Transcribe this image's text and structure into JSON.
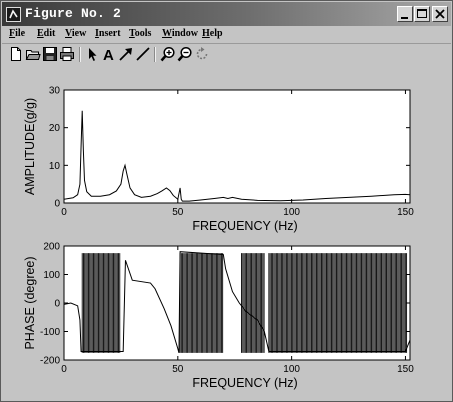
{
  "window": {
    "title": "Figure No. 2"
  },
  "menu": [
    {
      "label": "File",
      "u": "F",
      "rest": "ile"
    },
    {
      "label": "Edit",
      "u": "E",
      "rest": "dit"
    },
    {
      "label": "View",
      "u": "V",
      "rest": "iew"
    },
    {
      "label": "Insert",
      "u": "I",
      "rest": "nsert"
    },
    {
      "label": "Tools",
      "u": "T",
      "rest": "ools"
    },
    {
      "label": "Window",
      "u": "W",
      "rest": "indow"
    },
    {
      "label": "Help",
      "u": "H",
      "rest": "elp"
    }
  ],
  "toolbar": [
    "new-file-icon",
    "open-folder-icon",
    "save-icon",
    "print-icon",
    "select-arrow-icon",
    "insert-text-icon",
    "insert-arrow-icon",
    "insert-line-icon",
    "zoom-in-icon",
    "zoom-out-icon",
    "rotate-icon"
  ],
  "chart_data": [
    {
      "type": "line",
      "xlabel": "FREQUENCY (Hz)",
      "ylabel": "AMPLITUDE(g/g)",
      "xlim": [
        0,
        152
      ],
      "ylim": [
        0,
        30
      ],
      "xticks": [
        0,
        50,
        100,
        150
      ],
      "yticks": [
        0,
        10,
        20,
        30
      ],
      "grid": false,
      "color": "#000000",
      "x": [
        0,
        4,
        6,
        7,
        7.5,
        8,
        8.5,
        9,
        10,
        12,
        16,
        20,
        23,
        25,
        26,
        26.8,
        27.5,
        29,
        31,
        34,
        38,
        41,
        43,
        45,
        46.5,
        48,
        50,
        51,
        51.5,
        52,
        55,
        60,
        66,
        70,
        72,
        74,
        78,
        85,
        95,
        105,
        115,
        125,
        135,
        145,
        150,
        152
      ],
      "y": [
        1.0,
        1.4,
        2.2,
        5.0,
        15.0,
        24.5,
        14.0,
        6.0,
        3.0,
        1.8,
        1.8,
        2.2,
        3.2,
        5.0,
        8.5,
        10.0,
        8.0,
        4.0,
        2.2,
        1.5,
        1.8,
        2.5,
        3.2,
        4.0,
        3.3,
        2.0,
        1.0,
        4.0,
        1.0,
        0.5,
        0.5,
        0.8,
        1.2,
        1.5,
        1.2,
        1.5,
        1.0,
        0.7,
        0.6,
        0.8,
        1.2,
        1.5,
        1.8,
        2.2,
        2.3,
        2.2
      ]
    },
    {
      "type": "line",
      "xlabel": "FREQUENCY (Hz)",
      "ylabel": "PHASE (degree)",
      "xlim": [
        0,
        152
      ],
      "ylim": [
        -200,
        200
      ],
      "xticks": [
        0,
        50,
        100,
        150
      ],
      "yticks": [
        -200,
        -100,
        0,
        100,
        200
      ],
      "grid": false,
      "color": "#000000",
      "x": [
        0,
        3,
        6,
        7,
        7.5,
        26,
        27,
        30,
        38,
        40,
        44,
        47,
        50,
        50.5,
        51,
        70,
        71,
        74,
        77,
        80,
        85,
        88,
        90,
        150,
        152
      ],
      "y": [
        -5,
        0,
        -10,
        -60,
        -170,
        -170,
        150,
        80,
        70,
        50,
        -20,
        -80,
        -160,
        -175,
        180,
        170,
        120,
        40,
        0,
        -30,
        -60,
        -100,
        -170,
        -170,
        -130
      ],
      "wrap_bands": [
        [
          8,
          25
        ],
        [
          51,
          70
        ],
        [
          78,
          88
        ],
        [
          90,
          151
        ]
      ]
    }
  ]
}
